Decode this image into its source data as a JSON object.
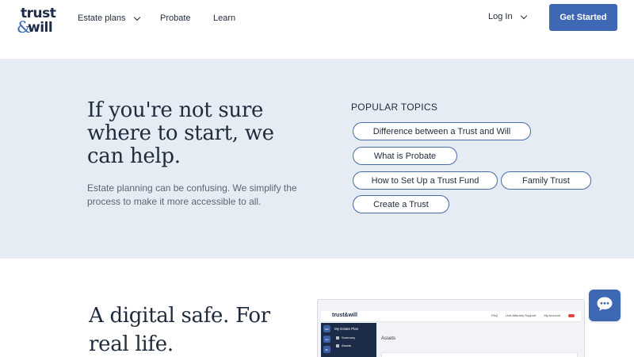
{
  "brand": {
    "logo_line1": "trust",
    "logo_amp": "&",
    "logo_line2": "will",
    "accent": "#3e67b4",
    "hero_bg": "#e6ecf4"
  },
  "nav": {
    "items": [
      {
        "label": "Estate plans",
        "has_dropdown": true
      },
      {
        "label": "Probate",
        "has_dropdown": false
      },
      {
        "label": "Learn",
        "has_dropdown": false
      }
    ],
    "login_label": "Log In",
    "cta_label": "Get Started"
  },
  "hero": {
    "title": "If you're not sure where to start, we can help.",
    "description": "Estate planning can be confusing. We simplify the process to make it more accessible to all.",
    "topics_label": "POPULAR TOPICS",
    "topics": [
      "Difference between a Trust and Will",
      "What is Probate",
      "How to Set Up a Trust Fund",
      "Family Trust",
      "Create a Trust"
    ]
  },
  "lower": {
    "title": "A digital safe. For real life."
  },
  "app_preview": {
    "logo": "trust&will",
    "top_links": [
      "FAQ",
      "Live Attorney Support",
      "My Account"
    ],
    "side_tabs": [
      "MO",
      "CH",
      "BL"
    ],
    "side_title": "My Estate Plan",
    "side_items": [
      "Summary",
      "Assets"
    ],
    "main_title": "Assets"
  },
  "chat": {
    "icon": "chat-bubble-icon"
  }
}
